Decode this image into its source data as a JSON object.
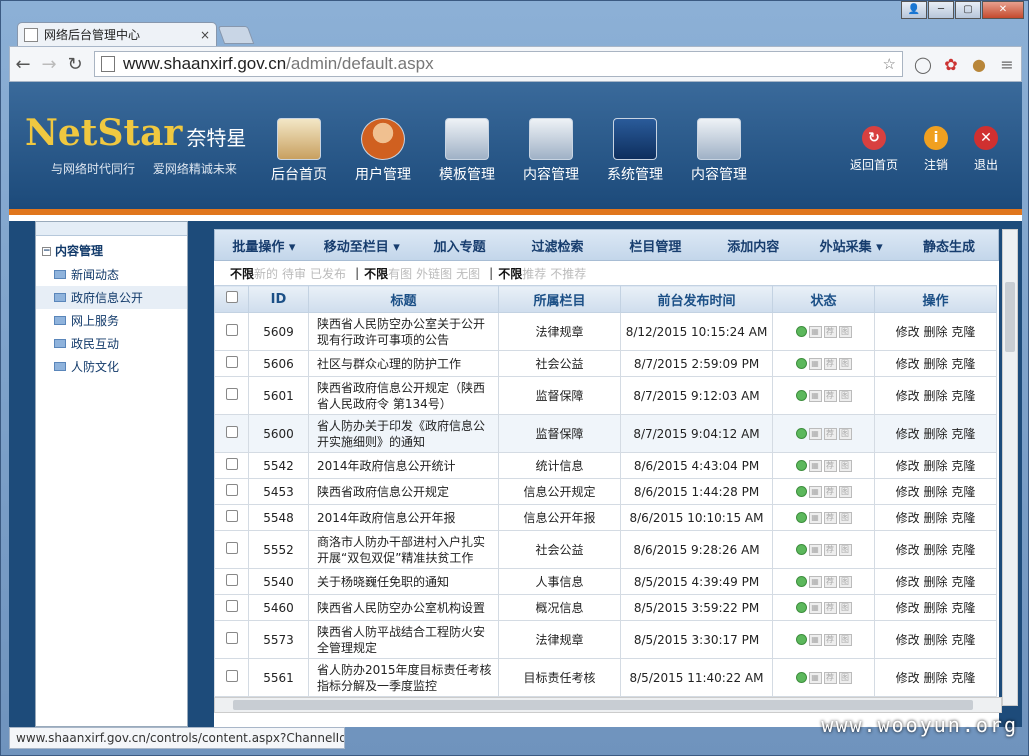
{
  "browser": {
    "tab_title": "网络后台管理中心",
    "url_host": "www.shaanxirf.gov.cn",
    "url_path": "/admin/default.aspx",
    "status_url": "www.shaanxirf.gov.cn/controls/content.aspx?ChannelId...",
    "watermark": "www.wooyun.org"
  },
  "header": {
    "logo": "NetStar",
    "logo_cn": "奈特星",
    "slogan": "与网络时代同行 爱网络精诚未来",
    "nav": [
      "后台首页",
      "用户管理",
      "模板管理",
      "内容管理",
      "系统管理",
      "内容管理"
    ],
    "right_nav": [
      "返回首页",
      "注销",
      "退出"
    ]
  },
  "sidebar": {
    "root": "内容管理",
    "items": [
      "新闻动态",
      "政府信息公开",
      "网上服务",
      "政民互动",
      "人防文化"
    ],
    "selected": 1
  },
  "actions": [
    "批量操作 ▾",
    "移动至栏目 ▾",
    "加入专题",
    "过滤检索",
    "栏目管理",
    "添加内容",
    "外站采集 ▾",
    "静态生成"
  ],
  "filters": {
    "g1": [
      "不限",
      "新的",
      "待审",
      "已发布"
    ],
    "g2": [
      "不限",
      "有图",
      "外链图",
      "无图"
    ],
    "g3": [
      "不限",
      "推荐",
      "不推荐"
    ]
  },
  "table": {
    "headers": [
      "",
      "ID",
      "标题",
      "所属栏目",
      "前台发布时间",
      "状态",
      "操作"
    ],
    "ops": [
      "修改",
      "删除",
      "克隆"
    ],
    "rows": [
      {
        "id": "5609",
        "title": "陕西省人民防空办公室关于公开现有行政许可事项的公告",
        "channel": "法律规章",
        "time": "8/12/2015 10:15:24 AM"
      },
      {
        "id": "5606",
        "title": "社区与群众心理的防护工作",
        "channel": "社会公益",
        "time": "8/7/2015 2:59:09 PM"
      },
      {
        "id": "5601",
        "title": "陕西省政府信息公开规定（陕西省人民政府令 第134号）",
        "channel": "监督保障",
        "time": "8/7/2015 9:12:03 AM"
      },
      {
        "id": "5600",
        "title": "省人防办关于印发《政府信息公开实施细则》的通知",
        "channel": "监督保障",
        "time": "8/7/2015 9:04:12 AM"
      },
      {
        "id": "5542",
        "title": "2014年政府信息公开统计",
        "channel": "统计信息",
        "time": "8/6/2015 4:43:04 PM"
      },
      {
        "id": "5453",
        "title": "陕西省政府信息公开规定",
        "channel": "信息公开规定",
        "time": "8/6/2015 1:44:28 PM"
      },
      {
        "id": "5548",
        "title": "2014年政府信息公开年报",
        "channel": "信息公开年报",
        "time": "8/6/2015 10:10:15 AM"
      },
      {
        "id": "5552",
        "title": "商洛市人防办干部进村入户扎实开展“双包双促”精准扶贫工作",
        "channel": "社会公益",
        "time": "8/6/2015 9:28:26 AM"
      },
      {
        "id": "5540",
        "title": "关于杨晓巍任免职的通知",
        "channel": "人事信息",
        "time": "8/5/2015 4:39:49 PM"
      },
      {
        "id": "5460",
        "title": "陕西省人民防空办公室机构设置",
        "channel": "概况信息",
        "time": "8/5/2015 3:59:22 PM"
      },
      {
        "id": "5573",
        "title": "陕西省人防平战结合工程防火安全管理规定",
        "channel": "法律规章",
        "time": "8/5/2015 3:30:17 PM"
      },
      {
        "id": "5561",
        "title": "省人防办2015年度目标责任考核指标分解及一季度监控",
        "channel": "目标责任考核",
        "time": "8/5/2015 11:40:22 AM"
      }
    ]
  }
}
